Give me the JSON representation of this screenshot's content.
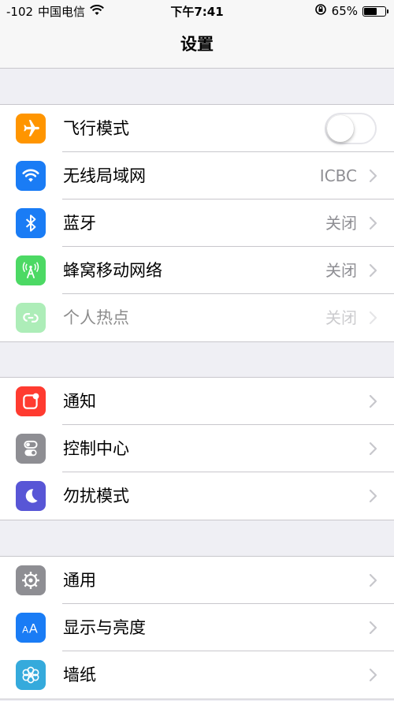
{
  "status": {
    "signal": "-102",
    "carrier": "中国电信",
    "time": "下午7:41",
    "battery": "65%",
    "battery_level": 0.65
  },
  "nav": {
    "title": "设置"
  },
  "groups": [
    {
      "items": [
        {
          "label": "飞行模式",
          "icon": "airplane-icon",
          "color": "#ff9500",
          "control": "toggle",
          "on": false
        },
        {
          "label": "无线局域网",
          "icon": "wifi-icon",
          "color": "#1a7cf5",
          "value": "ICBC"
        },
        {
          "label": "蓝牙",
          "icon": "bluetooth-icon",
          "color": "#1a7cf5",
          "value": "关闭"
        },
        {
          "label": "蜂窝移动网络",
          "icon": "cellular-icon",
          "color": "#4cd964",
          "value": "关闭"
        },
        {
          "label": "个人热点",
          "icon": "hotspot-icon",
          "color": "#4cd964",
          "value": "关闭",
          "disabled": true
        }
      ]
    },
    {
      "items": [
        {
          "label": "通知",
          "icon": "notifications-icon",
          "color": "#ff3b30"
        },
        {
          "label": "控制中心",
          "icon": "control-center-icon",
          "color": "#8e8e93"
        },
        {
          "label": "勿扰模式",
          "icon": "moon-icon",
          "color": "#5856d6"
        }
      ]
    },
    {
      "items": [
        {
          "label": "通用",
          "icon": "gear-icon",
          "color": "#8e8e93"
        },
        {
          "label": "显示与亮度",
          "icon": "display-icon",
          "color": "#1a7cf5"
        },
        {
          "label": "墙纸",
          "icon": "wallpaper-icon",
          "color": "#35aadc"
        }
      ]
    }
  ]
}
